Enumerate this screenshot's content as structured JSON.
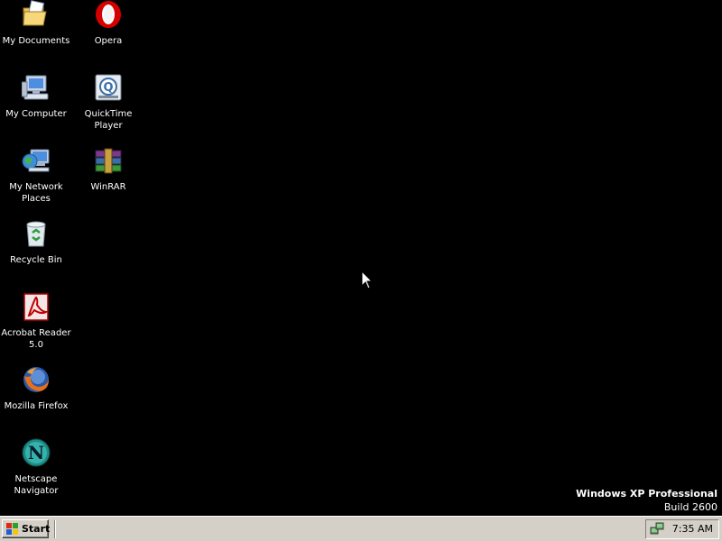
{
  "desktop": {
    "background_color": "#000000",
    "icons": [
      {
        "name": "my-documents-icon",
        "label": "My Documents"
      },
      {
        "name": "my-computer-icon",
        "label": "My Computer"
      },
      {
        "name": "my-network-places-icon",
        "label": "My Network\nPlaces"
      },
      {
        "name": "recycle-bin-icon",
        "label": "Recycle Bin"
      },
      {
        "name": "acrobat-reader-icon",
        "label": "Acrobat Reader\n5.0"
      },
      {
        "name": "mozilla-firefox-icon",
        "label": "Mozilla Firefox"
      },
      {
        "name": "netscape-navigator-icon",
        "label": "Netscape\nNavigator"
      },
      {
        "name": "opera-icon",
        "label": "Opera"
      },
      {
        "name": "quicktime-player-icon",
        "label": "QuickTime\nPlayer"
      },
      {
        "name": "winrar-icon",
        "label": "WinRAR"
      }
    ]
  },
  "watermark": {
    "title": "Windows XP Professional",
    "build": "Build 2600"
  },
  "taskbar": {
    "start_label": "Start",
    "clock": "7:35 AM",
    "tray_icon": "network-connection-icon"
  },
  "colors": {
    "taskbar": "#d4d0c8",
    "desktop": "#000000",
    "label_text": "#ffffff"
  }
}
